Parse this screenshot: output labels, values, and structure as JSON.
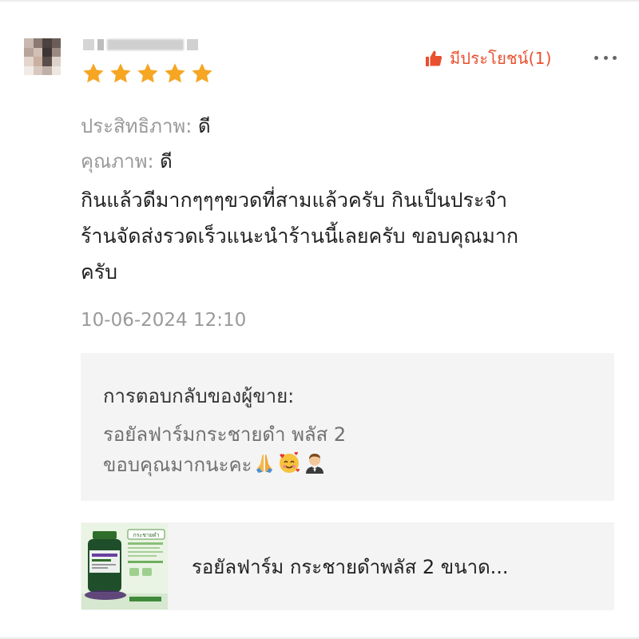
{
  "review": {
    "rating": 5,
    "helpful_label": "มีประโยชน์(1)",
    "attributes": [
      {
        "label": "ประสิทธิภาพ:",
        "value": "ดี"
      },
      {
        "label": "คุณภาพ:",
        "value": "ดี"
      }
    ],
    "text_lines": [
      "กินแล้วดีมากๆๆๆขวดที่สามแล้วครับ กินเป็นประจำ",
      "ร้านจัดส่งรวดเร็วแนะนำร้านนี้เลยครับ ขอบคุณมาก",
      "ครับ"
    ],
    "date": "10-06-2024 12:10"
  },
  "seller_reply": {
    "title": "การตอบกลับของผู้ขาย:",
    "line1": "รอยัลฟาร์มกระชายดำ พลัส 2",
    "line2": "ขอบคุณมากนะคะ",
    "emojis": [
      "folded-hands",
      "smiling-face-with-hearts",
      "person-in-tuxedo"
    ]
  },
  "product": {
    "name": "รอยัลฟาร์ม กระชายดำพลัส 2 ขนาด...",
    "thumbnail_label": "กระชายดำ"
  },
  "colors": {
    "accent": "#e8502e",
    "star": "#f6a623",
    "muted": "#999999",
    "panel": "#f4f4f4"
  }
}
